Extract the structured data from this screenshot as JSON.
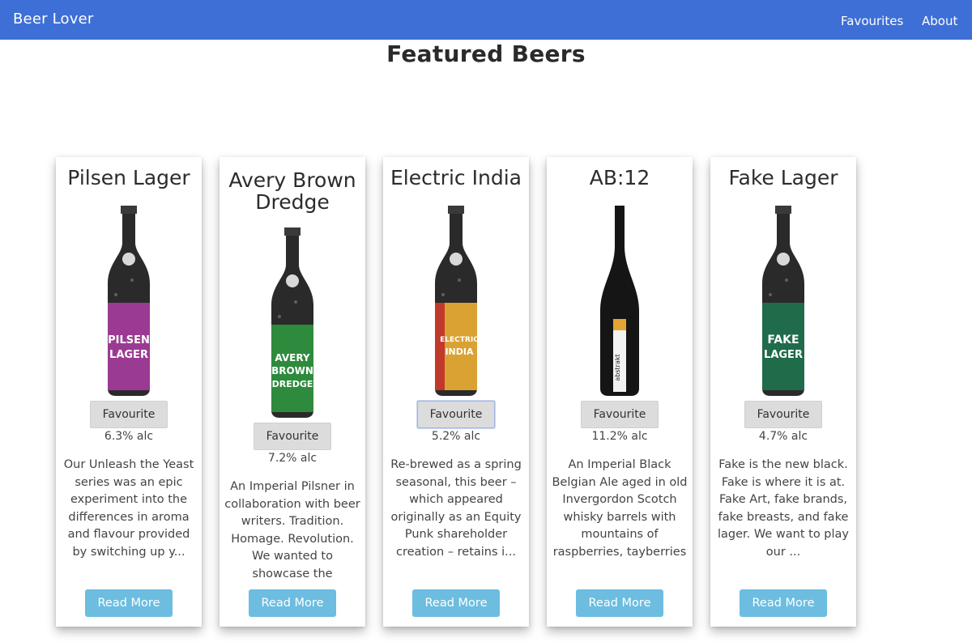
{
  "nav": {
    "brand": "Beer Lover",
    "favourites": "Favourites",
    "about": "About"
  },
  "page": {
    "title": "Featured Beers"
  },
  "colors": {
    "navbar": "#3d6fd6",
    "read_more": "#6cbde0",
    "favourite": "#dcdcdc"
  },
  "beers": [
    {
      "name": "Pilsen Lager",
      "favourite": "Favourite",
      "abv": "6.3% alc",
      "description": "Our Unleash the Yeast series was an epic experiment into the differences in aroma and flavour provided by switching up y...",
      "read_more": "Read More",
      "label_text": [
        "PILSEN",
        "LAGER"
      ],
      "label_color": "#9b3a93"
    },
    {
      "name": "Avery Brown Dredge",
      "favourite": "Favourite",
      "abv": "7.2% alc",
      "description": "An Imperial Pilsner in collaboration with beer writers. Tradition. Homage. Revolution. We wanted to showcase the awesome...",
      "read_more": "Read More",
      "label_text": [
        "AVERY",
        "BROWN",
        "DREDGE"
      ],
      "label_color": "#2e8a3c"
    },
    {
      "name": "Electric India",
      "favourite": "Favourite",
      "abv": "5.2% alc",
      "description": "Re-brewed as a spring seasonal, this beer – which appeared originally as an Equity Punk shareholder creation – retains i...",
      "read_more": "Read More",
      "label_text": [
        "ELECTRIC",
        "INDIA"
      ],
      "label_color": "#d9a233"
    },
    {
      "name": "AB:12",
      "favourite": "Favourite",
      "abv": "11.2% alc",
      "description": "An Imperial Black Belgian Ale aged in old Invergordon Scotch whisky barrels with mountains of raspberries, tayberries an...",
      "read_more": "Read More",
      "label_text": [
        "abstrakt"
      ],
      "label_color": "#f3f3f3"
    },
    {
      "name": "Fake Lager",
      "favourite": "Favourite",
      "abv": "4.7% alc",
      "description": "Fake is the new black. Fake is where it is at. Fake Art, fake brands, fake breasts, and fake lager. We want to play our ...",
      "read_more": "Read More",
      "label_text": [
        "FAKE",
        "LAGER"
      ],
      "label_color": "#1f6b4a"
    }
  ]
}
